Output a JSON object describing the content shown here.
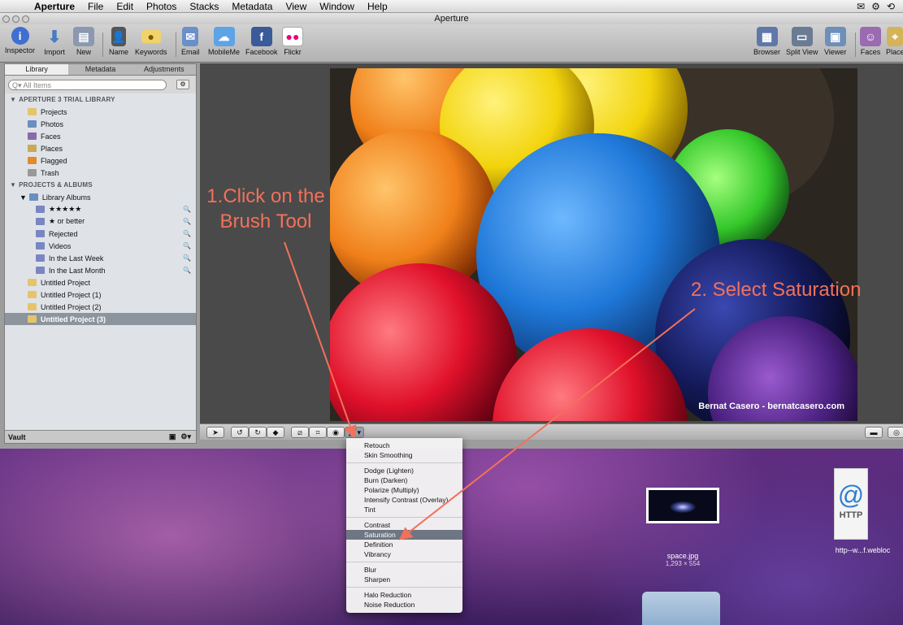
{
  "menubar": {
    "apple_icon": "apple-icon",
    "items": [
      "Aperture",
      "File",
      "Edit",
      "Photos",
      "Stacks",
      "Metadata",
      "View",
      "Window",
      "Help"
    ],
    "status_icons": [
      "✉",
      "⚙",
      "⟲"
    ]
  },
  "window": {
    "title": "Aperture",
    "toolbar": {
      "inspector": "Inspector",
      "import": "Import",
      "new": "New",
      "name": "Name",
      "keywords": "Keywords",
      "email": "Email",
      "mobileme": "MobileMe",
      "facebook": "Facebook",
      "flickr": "Flickr",
      "browser": "Browser",
      "split_view": "Split View",
      "viewer": "Viewer",
      "faces": "Faces",
      "places": "Place"
    }
  },
  "library": {
    "tabs": [
      "Library",
      "Metadata",
      "Adjustments"
    ],
    "search_placeholder": "All Items",
    "section1": "APERTURE 3 TRIAL LIBRARY",
    "items1": [
      "Projects",
      "Photos",
      "Faces",
      "Places",
      "Flagged",
      "Trash"
    ],
    "section2": "PROJECTS & ALBUMS",
    "albums_parent": "Library Albums",
    "albums": [
      "★★★★★",
      "★ or better",
      "Rejected",
      "Videos",
      "In the Last Week",
      "In the Last Month"
    ],
    "projects": [
      "Untitled Project",
      "Untitled Project (1)",
      "Untitled Project (2)",
      "Untitled Project (3)"
    ],
    "vault_label": "Vault"
  },
  "photo": {
    "watermark": "Bernat Casero - bernatcasero.com"
  },
  "annotations": {
    "step1_line1": "1.Click on the",
    "step1_line2": "Brush Tool",
    "step2": "2. Select Saturation"
  },
  "brush_menu": {
    "group1": [
      "Retouch",
      "Skin Smoothing"
    ],
    "group2": [
      "Dodge (Lighten)",
      "Burn (Darken)",
      "Polarize (Multiply)",
      "Intensify Contrast (Overlay)",
      "Tint"
    ],
    "group3": [
      "Contrast",
      "Saturation",
      "Definition",
      "Vibrancy"
    ],
    "group4": [
      "Blur",
      "Sharpen"
    ],
    "group5": [
      "Halo Reduction",
      "Noise Reduction"
    ],
    "selected": "Saturation"
  },
  "desktop": {
    "space_name": "space.jpg",
    "space_size": "1,293 × 554",
    "webloc_name": "http--w...f.webloc",
    "webloc_badge": "HTTP"
  },
  "colors": {
    "annotation": "#f2715a",
    "menu_selection": "#6e7683"
  }
}
